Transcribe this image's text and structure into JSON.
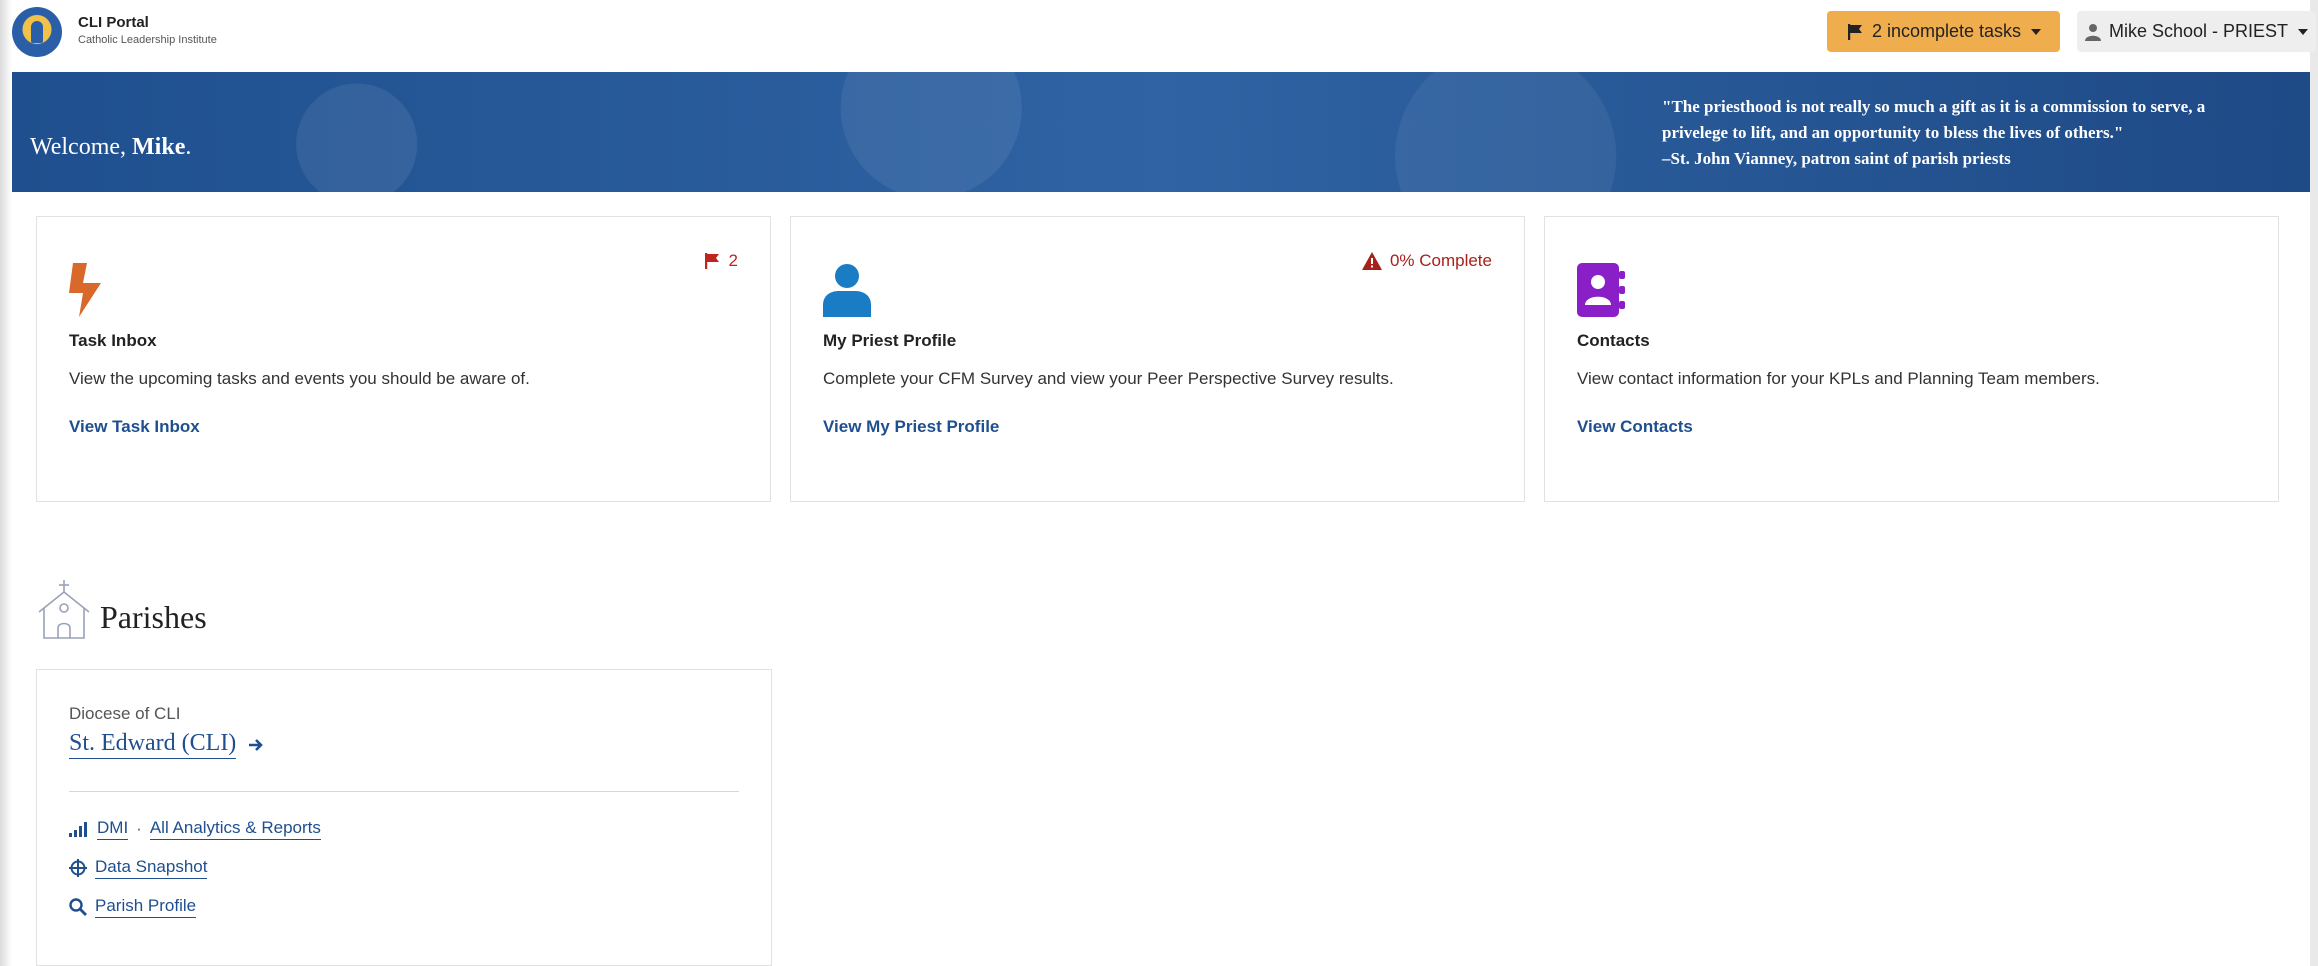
{
  "brand": {
    "title": "CLI Portal",
    "subtitle": "Catholic Leadership Institute"
  },
  "header": {
    "tasks_label": "2 incomplete tasks",
    "user_label": "Mike School - PRIEST"
  },
  "banner": {
    "welcome_prefix": "Welcome,",
    "welcome_name": "Mike",
    "welcome_suffix": ".",
    "quote_line1": "\"The priesthood is not really so much a gift as it is a commission to serve, a",
    "quote_line2": "privelege to lift, and an opportunity to bless the lives of others.\"",
    "quote_attribution": "–St. John Vianney, patron saint of parish priests"
  },
  "cards": [
    {
      "title": "Task Inbox",
      "badge": "2",
      "description": "View the upcoming tasks and events you should be aware of.",
      "link": "View Task Inbox"
    },
    {
      "title": "My Priest Profile",
      "badge": "0% Complete",
      "description": "Complete your CFM Survey and view your Peer Perspective Survey results.",
      "link": "View My Priest Profile"
    },
    {
      "title": "Contacts",
      "description": "View contact information for your KPLs and Planning Team members.",
      "link": "View Contacts"
    }
  ],
  "parishes": {
    "heading": "Parishes",
    "diocese": "Diocese of CLI",
    "parish_name": "St. Edward (CLI)",
    "links": {
      "dmi": "DMI",
      "separator": "·",
      "analytics": "All Analytics & Reports",
      "snapshot": "Data Snapshot",
      "profile": "Parish Profile"
    }
  },
  "colors": {
    "primary": "#1f4f8e",
    "warning": "#f0ad4e",
    "bolt": "#d9692a",
    "person": "#1a7cc4",
    "contacts": "#8a1fc7",
    "flag_red": "#c0241c",
    "alert_red": "#a8201a"
  }
}
